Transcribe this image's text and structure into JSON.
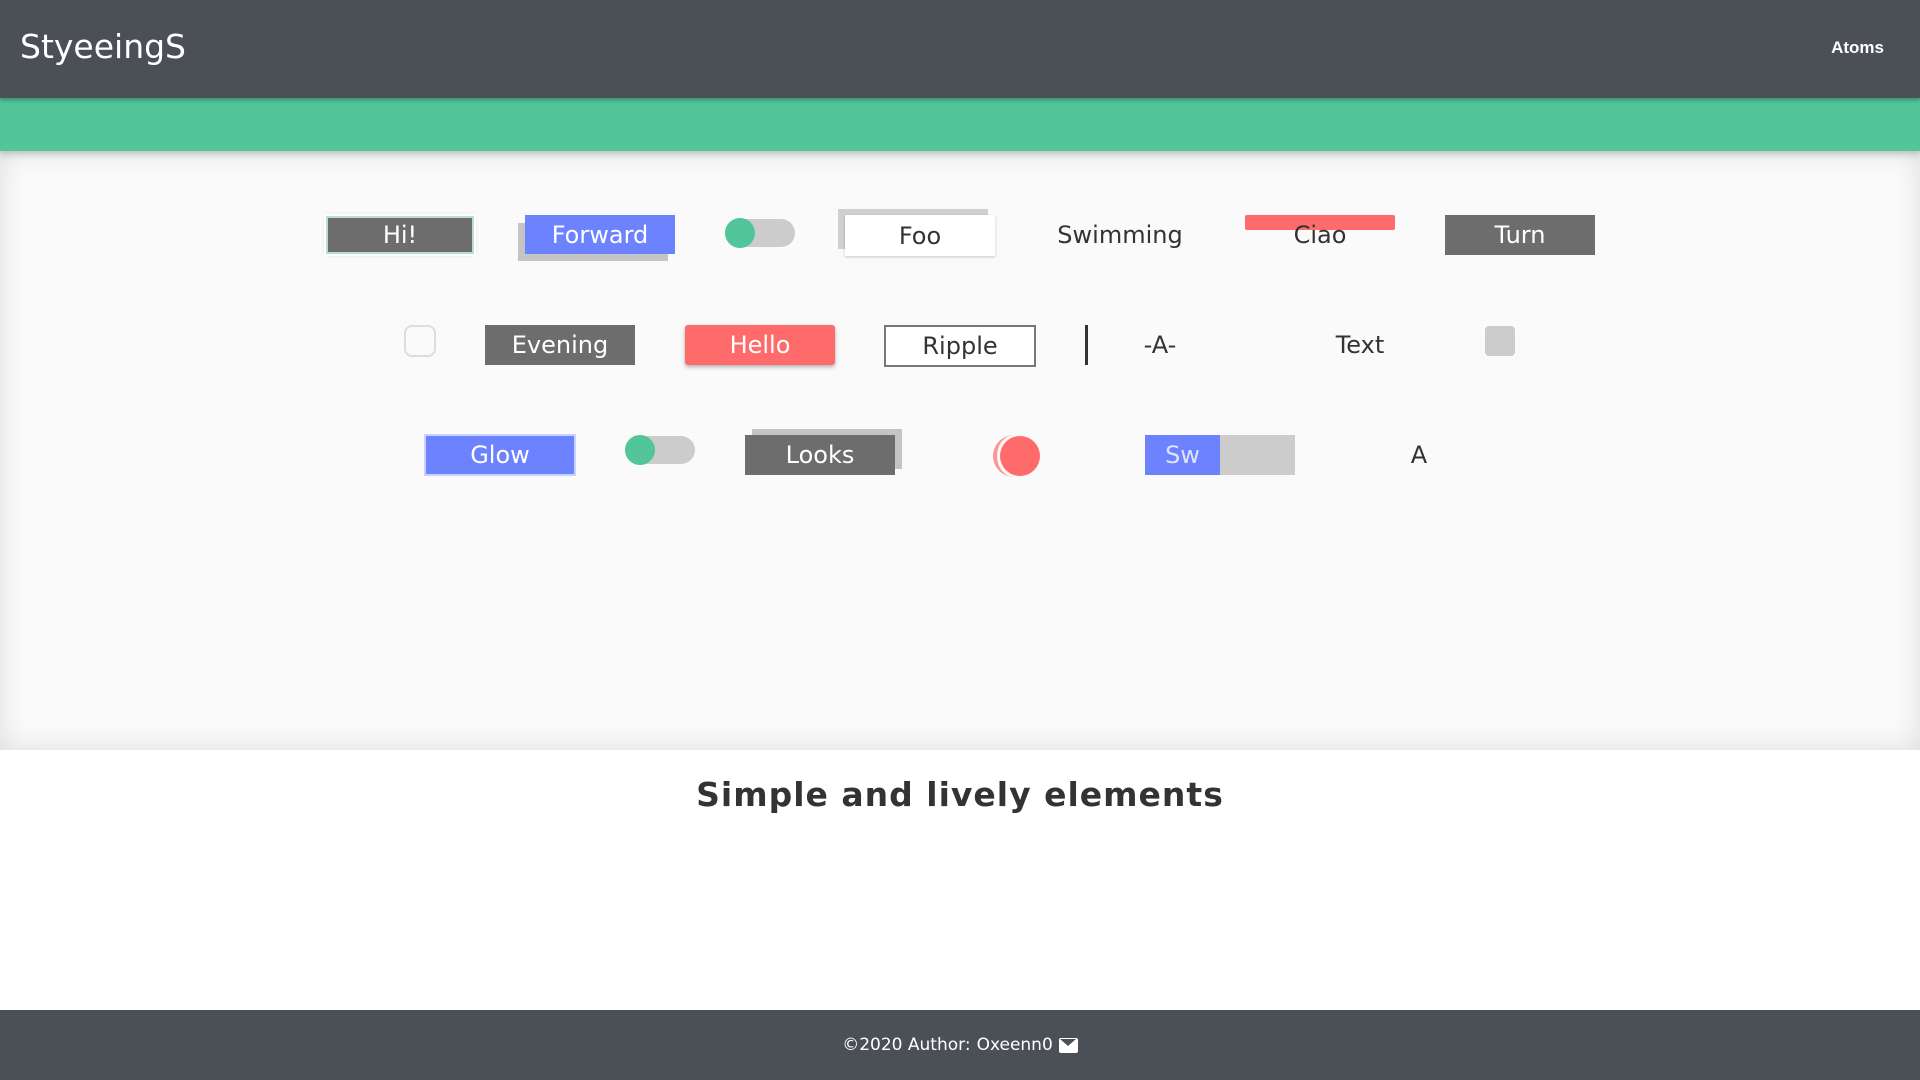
{
  "header": {
    "brand": "StyeeingS",
    "nav_atoms": "Atoms"
  },
  "row1": {
    "hi": "Hi!",
    "forward": "Forward",
    "foo": "Foo",
    "swimming": "Swimming",
    "ciao": "Ciao",
    "turn": "Turn"
  },
  "row2": {
    "evening": "Evening",
    "hello": "Hello",
    "ripple": "Ripple",
    "a_dashes": "-A-",
    "text": "Text"
  },
  "row3": {
    "glow": "Glow",
    "looks": "Looks",
    "sw": "Sw",
    "a": "A"
  },
  "tagline": "Simple and lively elements",
  "footer": {
    "copyright": "©2020 Author:",
    "author": "Oxeenn0",
    "mail_icon": "envelope-icon"
  },
  "colors": {
    "header": "#4b4f56",
    "green": "#52c59a",
    "blue": "#6c82ff",
    "red": "#ff6b6b",
    "dark_gray": "#6d6d6d"
  }
}
